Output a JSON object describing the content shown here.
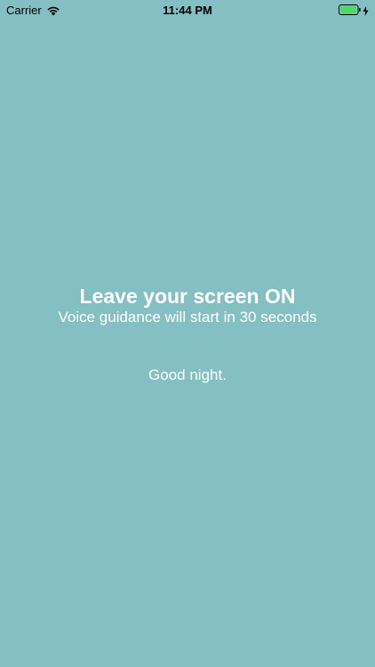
{
  "status_bar": {
    "carrier": "Carrier",
    "time": "11:44 PM",
    "battery_fill": 0.95,
    "battery_color": "#4cd964",
    "charging": true
  },
  "colors": {
    "background": "#84bfc3",
    "text": "#ffffff"
  },
  "message": {
    "headline": "Leave your screen ON",
    "subline": "Voice guidance will start in 30 seconds",
    "closing": "Good night."
  }
}
